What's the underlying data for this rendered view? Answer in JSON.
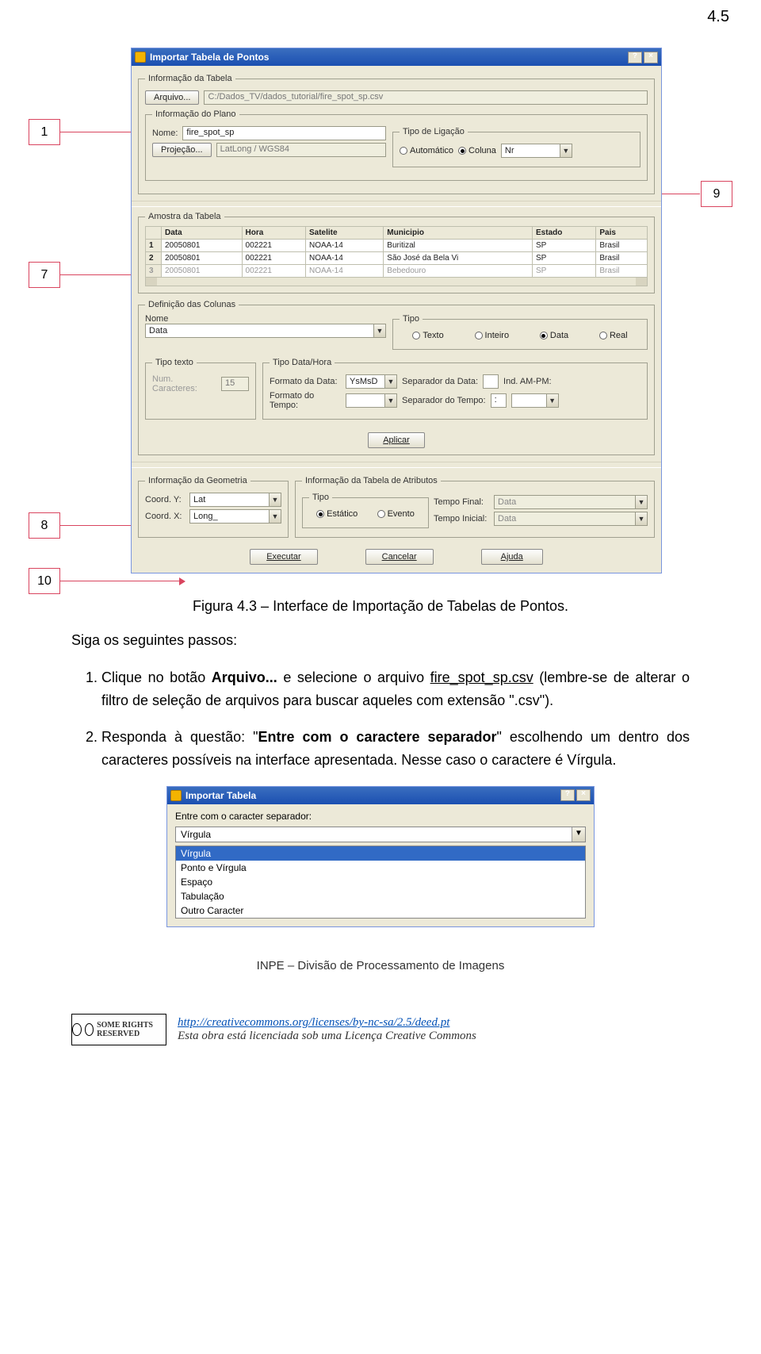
{
  "page_section_number": "4.5",
  "callouts": {
    "c1": "1",
    "c7": "7",
    "c8": "8",
    "c9": "9",
    "c10": "10"
  },
  "dialog": {
    "title": "Importar Tabela de Pontos",
    "group_info_tabela": "Informação da Tabela",
    "btn_arquivo": "Arquivo...",
    "path": "C:/Dados_TV/dados_tutorial/fire_spot_sp.csv",
    "group_info_plano": "Informação do Plano",
    "lbl_nome": "Nome:",
    "val_nome": "fire_spot_sp",
    "btn_projecao": "Projeção...",
    "val_projecao": "LatLong / WGS84",
    "group_tipo_ligacao": "Tipo de Ligação",
    "rb_auto": "Automático",
    "rb_coluna": "Coluna",
    "val_coluna": "Nr",
    "group_amostra": "Amostra da Tabela",
    "tbl": {
      "headers": [
        "",
        "Data",
        "Hora",
        "Satelite",
        "Municipio",
        "Estado",
        "Pais"
      ],
      "rows": [
        [
          "1",
          "20050801",
          "002221",
          "NOAA-14",
          "Buritizal",
          "SP",
          "Brasil"
        ],
        [
          "2",
          "20050801",
          "002221",
          "NOAA-14",
          "São José da Bela Vi",
          "SP",
          "Brasil"
        ],
        [
          "3",
          "20050801",
          "002221",
          "NOAA-14",
          "Bebedouro",
          "SP",
          "Brasil"
        ]
      ]
    },
    "group_def_col": "Definição das Colunas",
    "lbl_def_nome": "Nome",
    "val_def_nome": "Data",
    "lbl_def_tipo": "Tipo",
    "rb_texto": "Texto",
    "rb_inteiro": "Inteiro",
    "rb_data": "Data",
    "rb_real": "Real",
    "group_tipo_texto": "Tipo texto",
    "lbl_num_carac": "Num. Caracteres:",
    "val_num_carac": "15",
    "group_tipo_data": "Tipo Data/Hora",
    "lbl_fmt_data": "Formato da Data:",
    "val_fmt_data": "YsMsD",
    "lbl_sep_data": "Separador da Data:",
    "lbl_ind_ampm": "Ind. AM-PM:",
    "lbl_fmt_tempo": "Formato do Tempo:",
    "lbl_sep_tempo": "Separador do Tempo:",
    "val_sep_tempo": ":",
    "btn_aplicar": "Aplicar",
    "group_geom": "Informação da Geometria",
    "lbl_coord_y": "Coord. Y:",
    "val_coord_y": "Lat",
    "lbl_coord_x": "Coord. X:",
    "val_coord_x": "Long_",
    "group_tab_attr": "Informação da Tabela de Atributos",
    "group_tipo_attr": "Tipo",
    "rb_estatico": "Estático",
    "rb_evento": "Evento",
    "lbl_tempo_final": "Tempo Final:",
    "val_tempo_final": "Data",
    "lbl_tempo_inicial": "Tempo Inicial:",
    "val_tempo_inicial": "Data",
    "btn_executar": "Executar",
    "btn_cancelar": "Cancelar",
    "btn_ajuda": "Ajuda"
  },
  "caption": "Figura 4.3 – Interface de Importação de Tabelas de Pontos.",
  "intro": "Siga os seguintes passos:",
  "steps": {
    "s1_a": "Clique no botão ",
    "s1_b": "Arquivo...",
    "s1_c": " e selecione o arquivo ",
    "s1_file": "fire_spot_sp.csv",
    "s1_d": " (lembre-se de alterar o filtro de seleção de arquivos para buscar aqueles com extensão \".csv\").",
    "s2_a": "Responda à questão: \"",
    "s2_b": "Entre com o caractere separador",
    "s2_c": "\" escolhendo um dentro dos caracteres possíveis na interface apresentada. Nesse caso o caractere é Vírgula."
  },
  "dialog2": {
    "title": "Importar Tabela",
    "prompt": "Entre com o caracter separador:",
    "selected": "Vírgula",
    "options": [
      "Vírgula",
      "Ponto e Vírgula",
      "Espaço",
      "Tabulação",
      "Outro Caracter"
    ]
  },
  "footer_line": "INPE – Divisão de Processamento de Imagens",
  "cc": {
    "badge_text": "SOME RIGHTS RESERVED",
    "url": "http://creativecommons.org/licenses/by-nc-sa/2.5/deed.pt",
    "line": "Esta obra está licenciada sob uma Licença Creative Commons"
  }
}
